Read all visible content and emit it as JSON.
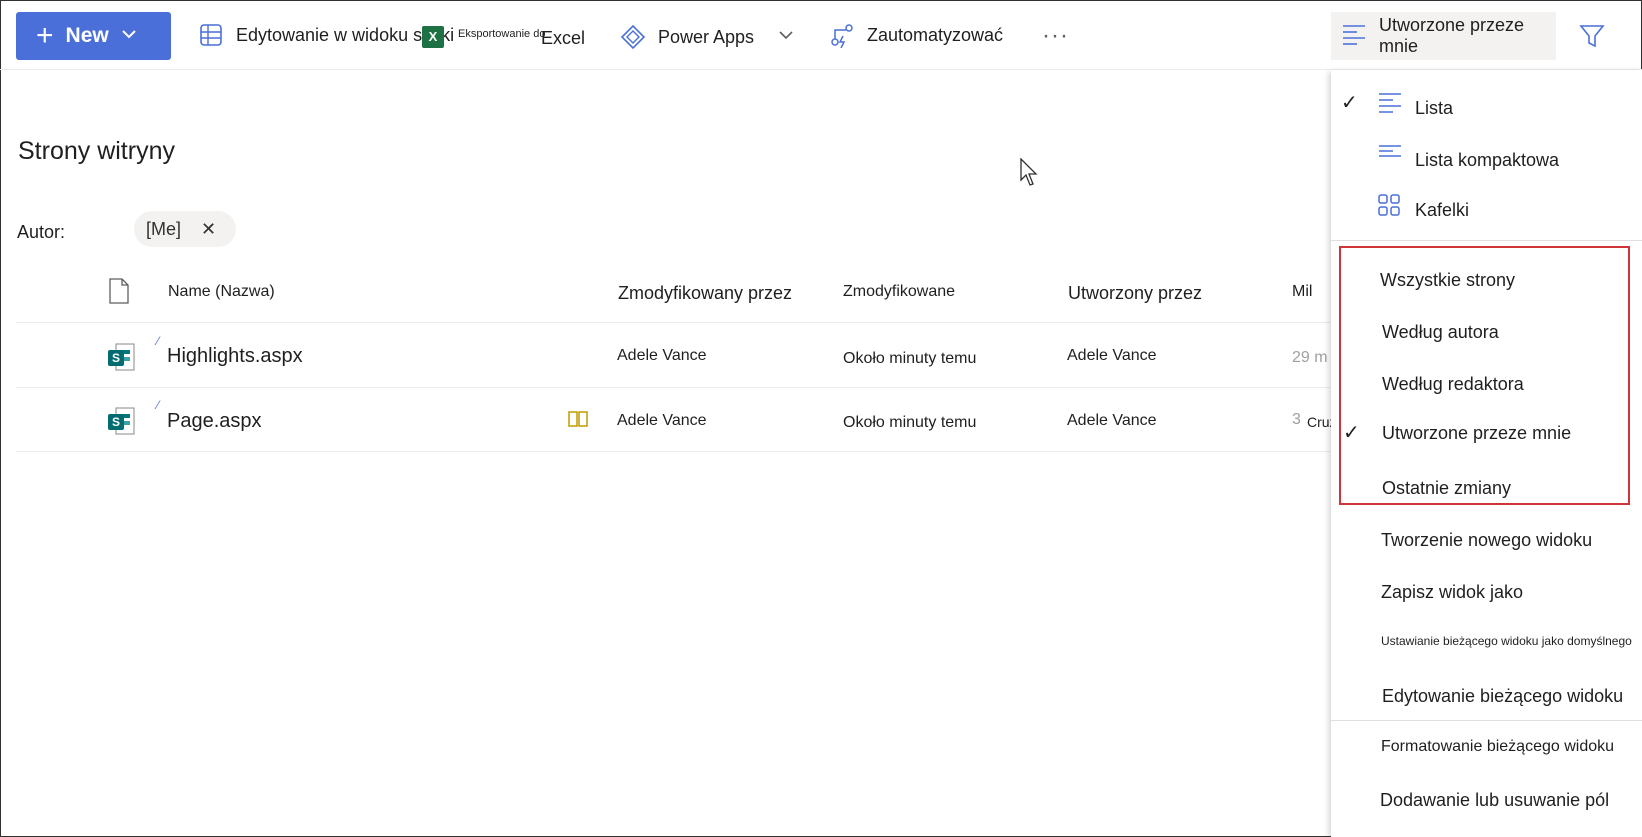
{
  "toolbar": {
    "new_label": "New",
    "grid_edit_label": "Edytowanie w widoku siatki",
    "export_prefix": "Eksportowanie do",
    "export_excel": "Excel",
    "power_apps_label": "Power Apps",
    "automate_label": "Zautomatyzować",
    "more_label": "···",
    "view_selector_label": "Utworzone przeze mnie"
  },
  "page": {
    "title": "Strony witryny",
    "filter_label": "Autor:",
    "filter_value": "[Me]"
  },
  "table": {
    "columns": {
      "name": "Name (Nazwa)",
      "modified_by": "Zmodyfikowany przez",
      "modified": "Zmodyfikowane",
      "created_by": "Utworzony przez",
      "extra": "Mil"
    },
    "rows": [
      {
        "name": "Highlights.aspx",
        "modified_by": "Adele Vance",
        "modified": "Około minuty temu",
        "created_by": "Adele Vance",
        "extra": "29 m",
        "extra2": ""
      },
      {
        "name": "Page.aspx",
        "modified_by": "Adele Vance",
        "modified": "Około minuty temu",
        "created_by": "Adele Vance",
        "extra": "3",
        "extra2": "Cruz"
      }
    ]
  },
  "menu": {
    "layouts": [
      {
        "label": "Lista",
        "checked": true
      },
      {
        "label": "Lista kompaktowa",
        "checked": false
      },
      {
        "label": "Kafelki",
        "checked": false
      }
    ],
    "views": [
      {
        "label": "Wszystkie strony",
        "checked": false
      },
      {
        "label": "Według autora",
        "checked": false
      },
      {
        "label": "Według redaktora",
        "checked": false
      },
      {
        "label": "Utworzone przeze mnie",
        "checked": true
      },
      {
        "label": "Ostatnie zmiany",
        "checked": false
      }
    ],
    "actions": {
      "create_view": "Tworzenie nowego widoku",
      "save_view_as": "Zapisz widok jako",
      "set_default": "Ustawianie bieżącego widoku jako domyślnego",
      "edit_view": "Edytowanie bieżącego widoku",
      "format_view": "Formatowanie bieżącego widoku",
      "add_remove_columns": "Dodawanie lub usuwanie pól"
    }
  },
  "colors": {
    "accent": "#4b6fd9",
    "highlight_border": "#d13438",
    "sharepoint_green": "#036c70"
  }
}
